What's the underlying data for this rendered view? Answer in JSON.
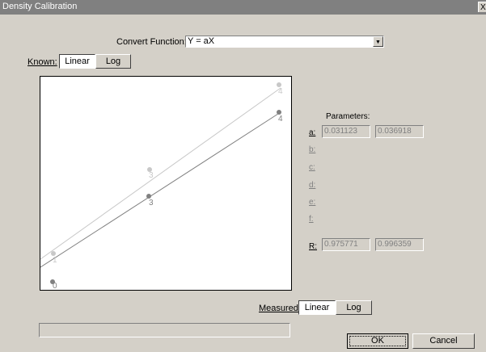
{
  "window": {
    "title": "Density Calibration",
    "close_label": "X"
  },
  "convert": {
    "label": "Convert Function:",
    "label_mnemonic_index": 3,
    "value": "Y = aX"
  },
  "known": {
    "label": "Known:",
    "buttons": [
      "Linear",
      "Log"
    ],
    "selected": "Linear"
  },
  "measured": {
    "label": "Measured:",
    "buttons": [
      "Linear",
      "Log"
    ],
    "selected": "Linear"
  },
  "parameters": {
    "heading": "Parameters:",
    "rows": [
      {
        "label": "a:",
        "enabled": true,
        "v1": "0.031123",
        "v2": "0.036918"
      },
      {
        "label": "b:",
        "enabled": false
      },
      {
        "label": "c:",
        "enabled": false
      },
      {
        "label": "d:",
        "enabled": false
      },
      {
        "label": "e:",
        "enabled": false
      },
      {
        "label": "f:",
        "enabled": false
      },
      {
        "label": "R:",
        "enabled": true,
        "v1": "0.975771",
        "v2": "0.996359"
      }
    ]
  },
  "buttons": {
    "ok": "OK",
    "cancel": "Cancel"
  },
  "plot": {
    "series": [
      {
        "color": "#c8c8c8",
        "point_labels": [
          "0",
          "1",
          "3",
          "4"
        ]
      },
      {
        "color": "#808080",
        "point_labels": [
          "0",
          "3",
          "4"
        ]
      }
    ]
  }
}
